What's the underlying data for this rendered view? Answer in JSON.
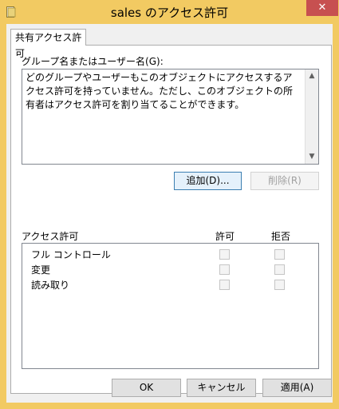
{
  "window": {
    "title": "sales のアクセス許可",
    "close_label": "✕",
    "title_icon": "folder-icon"
  },
  "tab": {
    "label": "共有アクセス許可"
  },
  "groups": {
    "label": "グループ名またはユーザー名(G):",
    "message": "どのグループやユーザーもこのオブジェクトにアクセスするアクセス許可を持っていません。ただし、このオブジェクトの所有者はアクセス許可を割り当てることができます。",
    "scroll_up": "▲",
    "scroll_down": "▼"
  },
  "buttons": {
    "add": "追加(D)...",
    "remove": "削除(R)",
    "ok": "OK",
    "cancel": "キャンセル",
    "apply": "適用(A)"
  },
  "permissions": {
    "label": "アクセス許可",
    "allow_label": "許可",
    "deny_label": "拒否",
    "rows": [
      {
        "name": "フル コントロール",
        "allow": false,
        "deny": false
      },
      {
        "name": "変更",
        "allow": false,
        "deny": false
      },
      {
        "name": "読み取り",
        "allow": false,
        "deny": false
      }
    ]
  },
  "colors": {
    "titlebar": "#f2ca62",
    "close_button": "#c75050"
  }
}
